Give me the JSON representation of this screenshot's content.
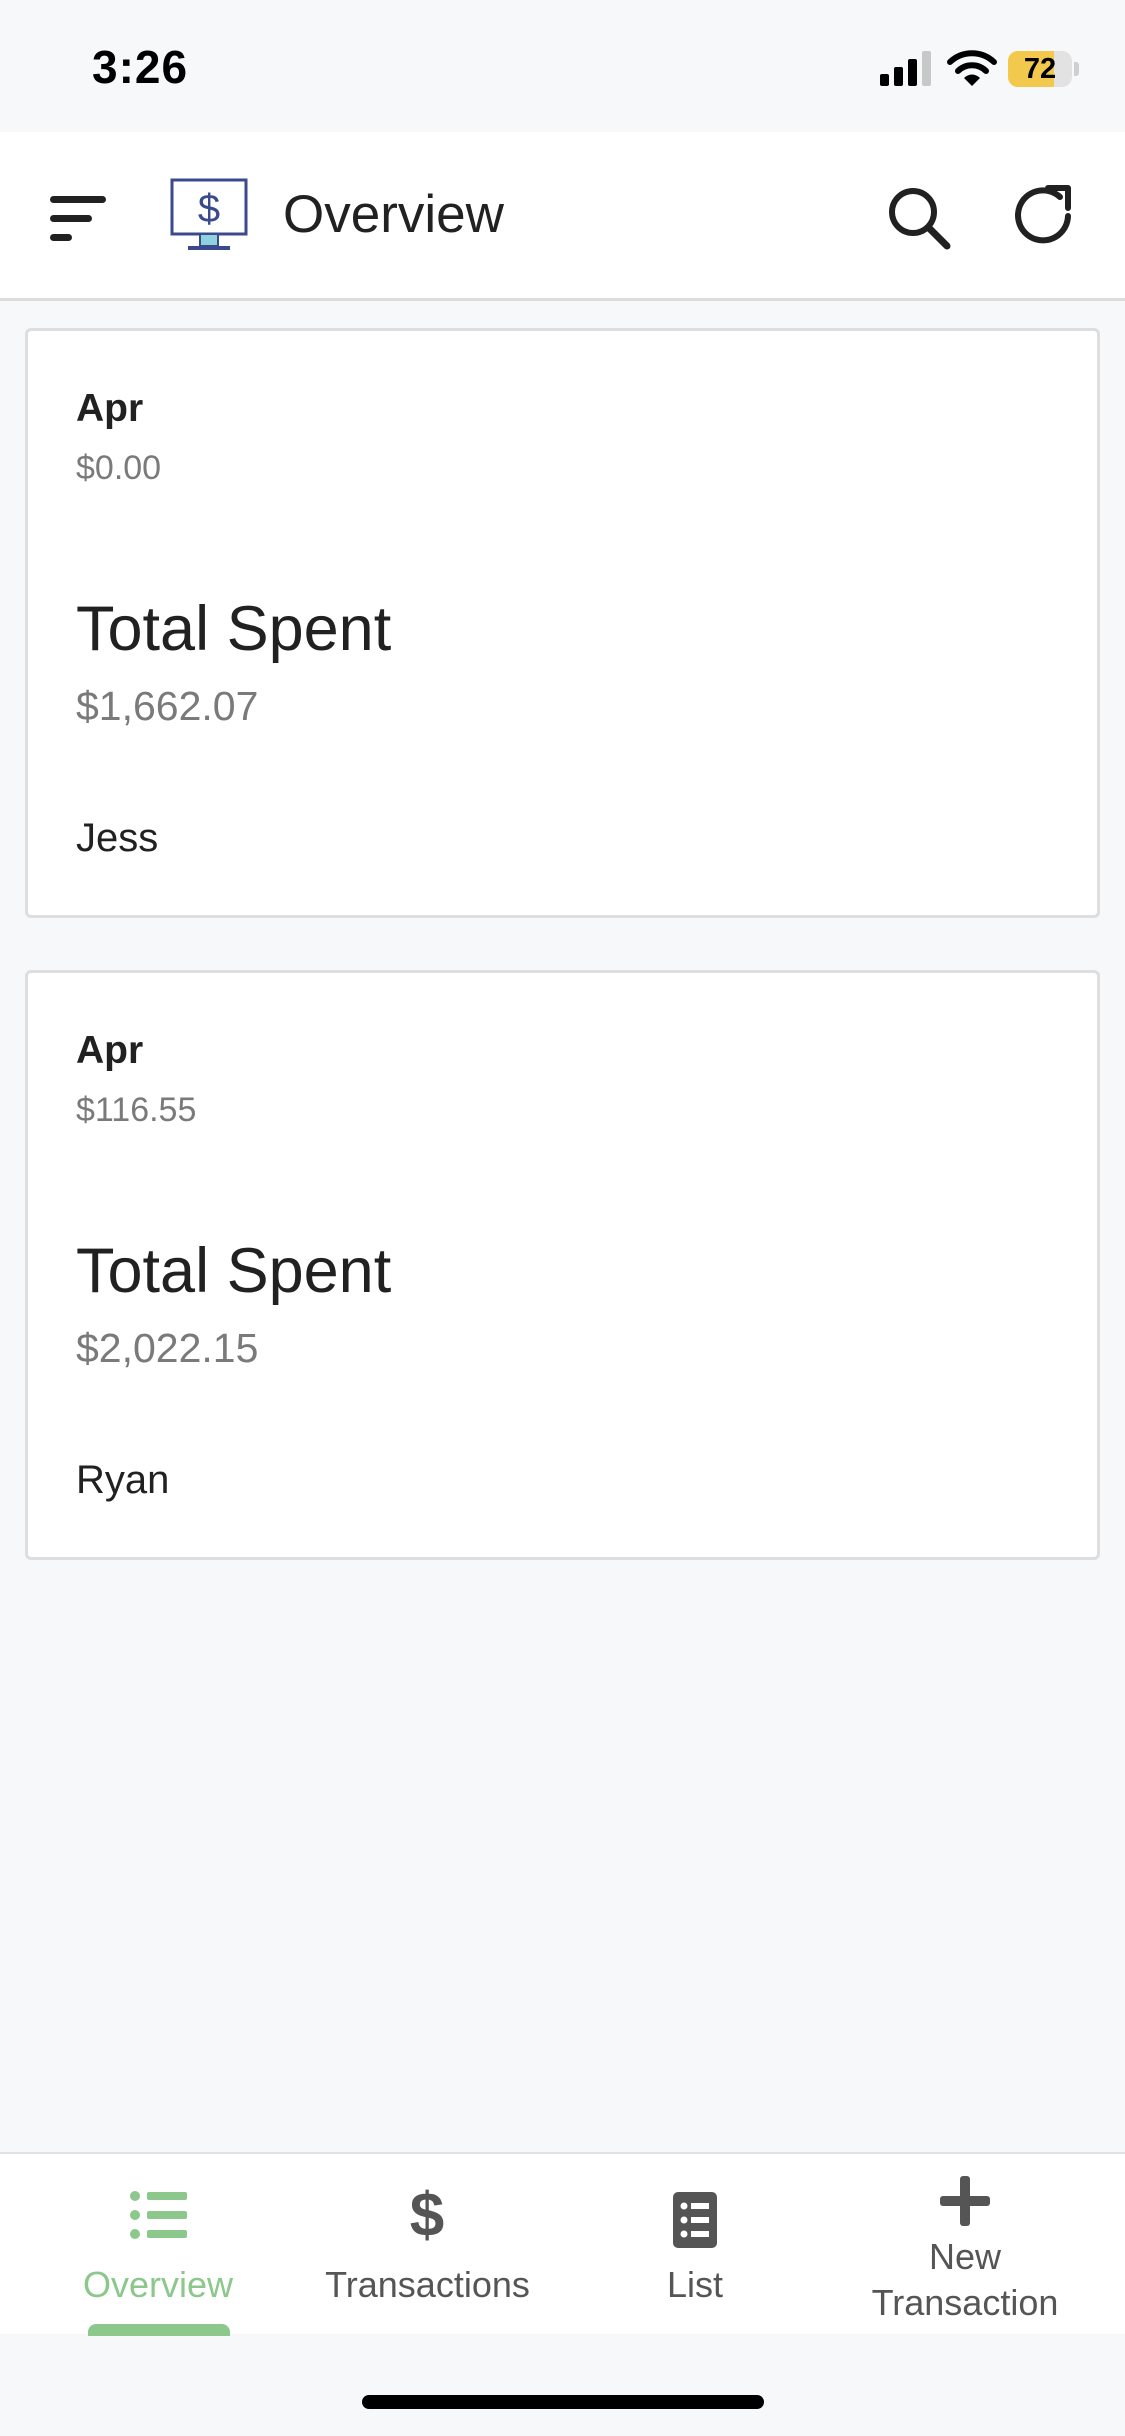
{
  "status_bar": {
    "time": "3:26",
    "battery_level": "72",
    "battery_fraction": 0.72,
    "battery_color": "#f2c94c"
  },
  "app_bar": {
    "title": "Overview",
    "icons": [
      "menu-icon",
      "money-monitor-logo-icon",
      "search-icon",
      "refresh-icon"
    ]
  },
  "cards": [
    {
      "month": "Apr",
      "month_amount": "$0.00",
      "total_label": "Total Spent",
      "total_amount": "$1,662.07",
      "name": "Jess"
    },
    {
      "month": "Apr",
      "month_amount": "$116.55",
      "total_label": "Total Spent",
      "total_amount": "$2,022.15",
      "name": "Ryan"
    }
  ],
  "bottom_nav": {
    "accent_color": "#8cc78c",
    "items": [
      {
        "label": "Overview",
        "icon": "list-bullets-icon",
        "active": true
      },
      {
        "label": "Transactions",
        "icon": "dollar-icon",
        "active": false
      },
      {
        "label": "List",
        "icon": "document-list-icon",
        "active": false
      },
      {
        "label_line1": "New",
        "label_line2": "Transaction",
        "icon": "plus-icon",
        "active": false
      }
    ]
  }
}
